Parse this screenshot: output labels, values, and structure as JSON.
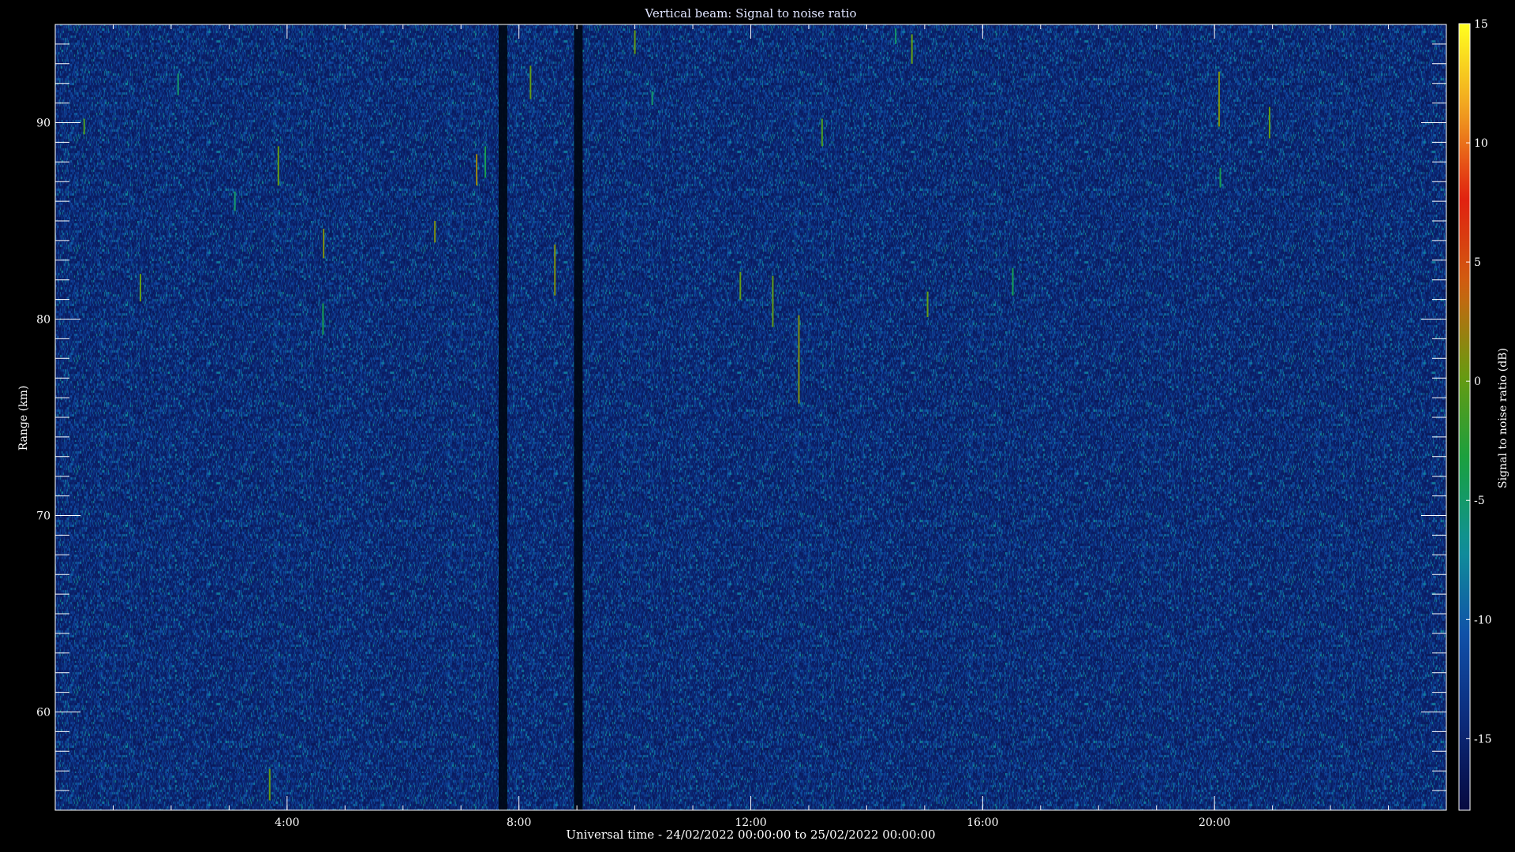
{
  "chart_data": {
    "type": "heatmap",
    "title": "Vertical beam: Signal to noise ratio",
    "xlabel": "Universal time - 24/02/2022 00:00:00 to 25/02/2022 00:00:00",
    "ylabel": "Range (km)",
    "colorbar_label": "Signal to noise ratio (dB)",
    "x_unit": "hours UT",
    "xlim": [
      0,
      24
    ],
    "ylim": [
      55,
      95
    ],
    "x_ticks": [
      {
        "value": 4,
        "label": "4:00"
      },
      {
        "value": 8,
        "label": "8:00"
      },
      {
        "value": 12,
        "label": "12:00"
      },
      {
        "value": 16,
        "label": "16:00"
      },
      {
        "value": 20,
        "label": "20:00"
      }
    ],
    "y_ticks": [
      {
        "value": 60,
        "label": "60"
      },
      {
        "value": 70,
        "label": "70"
      },
      {
        "value": 80,
        "label": "80"
      },
      {
        "value": 90,
        "label": "90"
      }
    ],
    "colorbar_range": [
      -18,
      15
    ],
    "colorbar_ticks": [
      {
        "value": 15,
        "label": "15"
      },
      {
        "value": 10,
        "label": "10"
      },
      {
        "value": 5,
        "label": "5"
      },
      {
        "value": 0,
        "label": "0"
      },
      {
        "value": -5,
        "label": "-5"
      },
      {
        "value": -10,
        "label": "-10"
      },
      {
        "value": -15,
        "label": "-15"
      }
    ],
    "colormap": [
      "#070a40",
      "#0c2a7a",
      "#1050a8",
      "#10909a",
      "#18a040",
      "#6a9a10",
      "#d06010",
      "#e02010",
      "#f0a020",
      "#ffff20"
    ],
    "background_level_db": -15,
    "data_gaps": [
      {
        "x_start": 7.65,
        "x_end": 7.8
      },
      {
        "x_start": 8.95,
        "x_end": 9.1
      }
    ],
    "notable_echoes": [
      {
        "x": 0.5,
        "y_min": 89.4,
        "y_max": 90.2,
        "snr": -1
      },
      {
        "x": 1.47,
        "y_min": 80.9,
        "y_max": 82.3,
        "snr": 0
      },
      {
        "x": 3.85,
        "y_min": 86.8,
        "y_max": 88.8,
        "snr": 0
      },
      {
        "x": 3.7,
        "y_min": 55.5,
        "y_max": 57.1,
        "snr": 0
      },
      {
        "x": 4.63,
        "y_min": 83.1,
        "y_max": 84.6,
        "snr": 1
      },
      {
        "x": 4.62,
        "y_min": 79.2,
        "y_max": 80.8,
        "snr": -4
      },
      {
        "x": 6.55,
        "y_min": 83.9,
        "y_max": 85.0,
        "snr": 1
      },
      {
        "x": 7.27,
        "y_min": 86.8,
        "y_max": 88.4,
        "snr": 2
      },
      {
        "x": 7.42,
        "y_min": 87.2,
        "y_max": 88.8,
        "snr": -4
      },
      {
        "x": 8.2,
        "y_min": 91.2,
        "y_max": 92.9,
        "snr": 0
      },
      {
        "x": 8.62,
        "y_min": 81.2,
        "y_max": 83.8,
        "snr": 1
      },
      {
        "x": 10.0,
        "y_min": 93.5,
        "y_max": 94.7,
        "snr": 0
      },
      {
        "x": 11.82,
        "y_min": 81.0,
        "y_max": 82.4,
        "snr": 0
      },
      {
        "x": 12.38,
        "y_min": 79.6,
        "y_max": 82.2,
        "snr": 0
      },
      {
        "x": 12.83,
        "y_min": 75.7,
        "y_max": 80.2,
        "snr": 1
      },
      {
        "x": 13.23,
        "y_min": 88.8,
        "y_max": 90.2,
        "snr": -1
      },
      {
        "x": 14.78,
        "y_min": 93.0,
        "y_max": 94.5,
        "snr": 0
      },
      {
        "x": 15.05,
        "y_min": 80.1,
        "y_max": 81.4,
        "snr": 0
      },
      {
        "x": 16.52,
        "y_min": 81.2,
        "y_max": 82.6,
        "snr": -4
      },
      {
        "x": 20.08,
        "y_min": 89.8,
        "y_max": 92.6,
        "snr": 1
      },
      {
        "x": 20.1,
        "y_min": 86.7,
        "y_max": 87.7,
        "snr": -4
      },
      {
        "x": 20.95,
        "y_min": 89.2,
        "y_max": 90.8,
        "snr": 0
      },
      {
        "x": 10.3,
        "y_min": 90.9,
        "y_max": 91.6,
        "snr": -5
      },
      {
        "x": 14.5,
        "y_min": 94.0,
        "y_max": 94.8,
        "snr": -5
      },
      {
        "x": 2.12,
        "y_min": 91.4,
        "y_max": 92.5,
        "snr": -5
      },
      {
        "x": 3.1,
        "y_min": 85.5,
        "y_max": 86.5,
        "snr": -5
      }
    ]
  }
}
